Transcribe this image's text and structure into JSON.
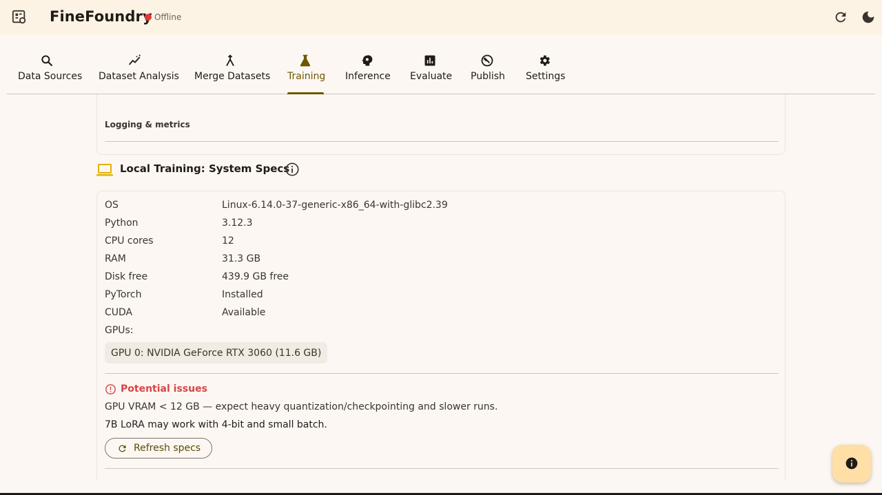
{
  "app": {
    "title": "FineFoundry",
    "status": "Offline",
    "colors": {
      "appbar_bg": "#fcf3e5",
      "accent": "#6e5600",
      "status_offline": "#e53935",
      "warning_red": "#d64545",
      "laptop_icon": "#e0b100",
      "fab_bg": "#ffdfa5"
    }
  },
  "header_actions": {
    "refresh_icon": "refresh-icon",
    "theme_icon": "moon-icon"
  },
  "tabs": [
    {
      "label": "Data Sources",
      "icon": "search-icon"
    },
    {
      "label": "Dataset Analysis",
      "icon": "insights-icon"
    },
    {
      "label": "Merge Datasets",
      "icon": "merge-icon"
    },
    {
      "label": "Training",
      "icon": "flask-icon",
      "active": true
    },
    {
      "label": "Inference",
      "icon": "psychology-icon"
    },
    {
      "label": "Evaluate",
      "icon": "bar-chart-icon"
    },
    {
      "label": "Publish",
      "icon": "build-circle-icon"
    },
    {
      "label": "Settings",
      "icon": "gear-icon"
    }
  ],
  "top_card": {
    "logging_heading": "Logging & metrics"
  },
  "system_specs": {
    "title": "Local Training: System Specs",
    "rows": [
      {
        "key": "OS",
        "value": "Linux-6.14.0-37-generic-x86_64-with-glibc2.39"
      },
      {
        "key": "Python",
        "value": "3.12.3"
      },
      {
        "key": "CPU cores",
        "value": "12"
      },
      {
        "key": "RAM",
        "value": "31.3 GB"
      },
      {
        "key": "Disk free",
        "value": "439.9 GB free"
      },
      {
        "key": "PyTorch",
        "value": "Installed"
      },
      {
        "key": "CUDA",
        "value": "Available"
      }
    ],
    "gpus_label": "GPUs:",
    "gpus": [
      "GPU 0: NVIDIA GeForce RTX 3060 (11.6 GB)"
    ],
    "issues_title": "Potential issues",
    "issues": [
      "GPU VRAM < 12 GB — expect heavy quantization/checkpointing and slower runs.",
      "7B LoRA may work with 4-bit and small batch."
    ],
    "refresh_button": "Refresh specs"
  },
  "fab": {
    "icon": "info-icon"
  }
}
